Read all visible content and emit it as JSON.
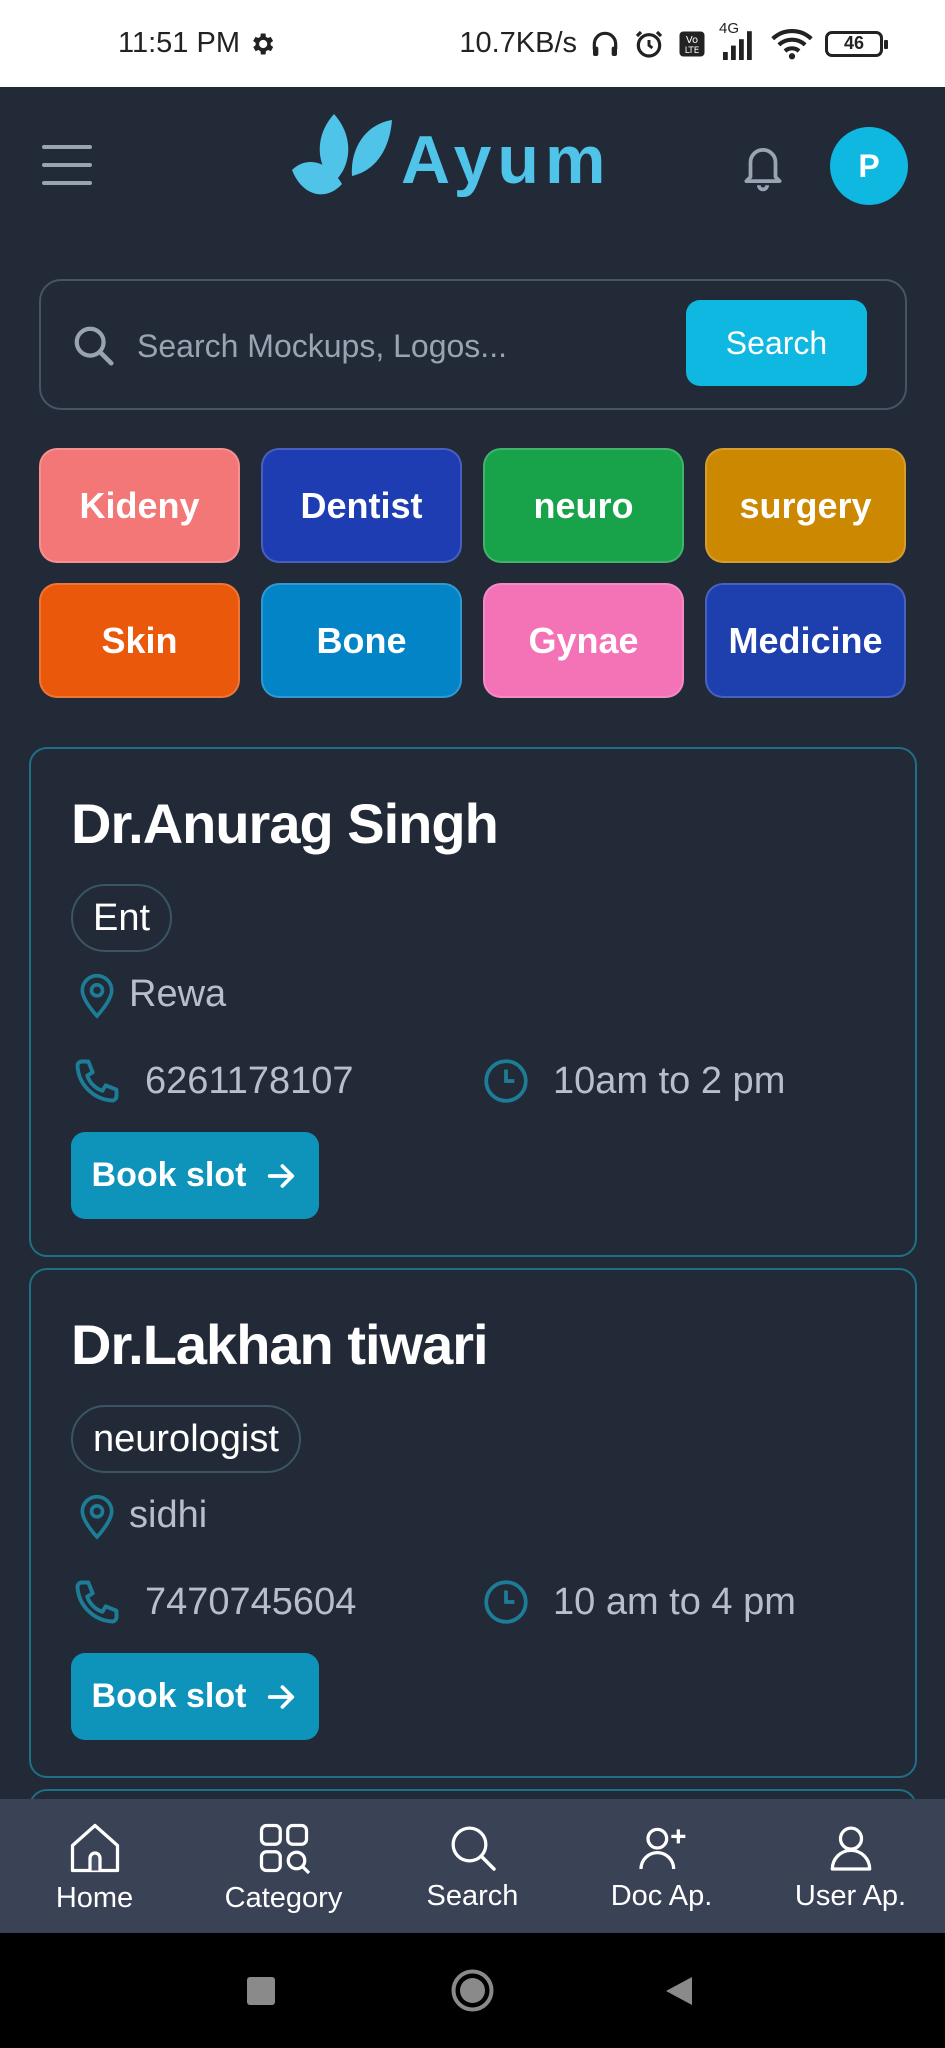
{
  "status_bar": {
    "time": "11:51 PM",
    "network_speed": "10.7KB/s",
    "network_type": "4G",
    "battery": "46"
  },
  "header": {
    "app_name": "Ayum",
    "avatar_initial": "P"
  },
  "search": {
    "placeholder": "Search Mockups, Logos...",
    "button_label": "Search"
  },
  "categories": [
    {
      "label": "Kideny",
      "color": "#f47777"
    },
    {
      "label": "Dentist",
      "color": "#1f3db3"
    },
    {
      "label": "neuro",
      "color": "#18a34a"
    },
    {
      "label": "surgery",
      "color": "#cc8800"
    },
    {
      "label": "Skin",
      "color": "#ea580c"
    },
    {
      "label": "Bone",
      "color": "#0284c7"
    },
    {
      "label": "Gynae",
      "color": "#f472b6"
    },
    {
      "label": "Medicine",
      "color": "#1e40af"
    }
  ],
  "doctors": [
    {
      "name": "Dr.Anurag Singh",
      "specialty": "Ent",
      "location": "Rewa",
      "phone": "6261178107",
      "hours": "10am to 2 pm",
      "book_label": "Book slot"
    },
    {
      "name": "Dr.Lakhan tiwari",
      "specialty": "neurologist",
      "location": "sidhi",
      "phone": "7470745604",
      "hours": "10 am to 4 pm",
      "book_label": "Book slot"
    }
  ],
  "bottom_nav": [
    {
      "label": "Home",
      "icon": "home-icon"
    },
    {
      "label": "Category",
      "icon": "category-icon"
    },
    {
      "label": "Search",
      "icon": "search-icon"
    },
    {
      "label": "Doc Ap.",
      "icon": "add-user-icon"
    },
    {
      "label": "User Ap.",
      "icon": "user-icon"
    }
  ],
  "colors": {
    "background": "#222a38",
    "accent": "#0fb8e0",
    "book_button": "#0e93bb",
    "card_border": "#1f6f86",
    "bottom_nav": "#3a4256"
  }
}
